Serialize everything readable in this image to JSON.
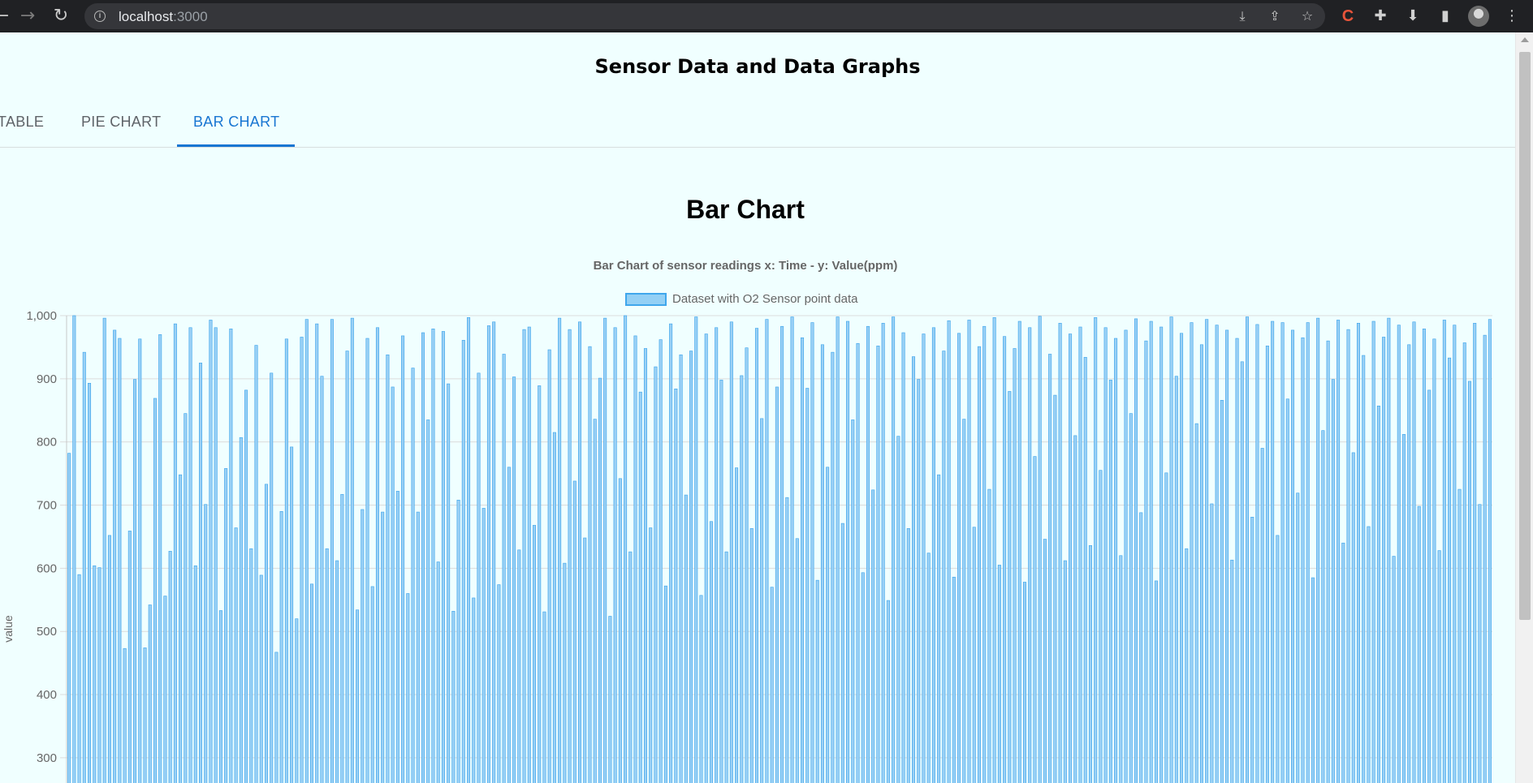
{
  "browser": {
    "url_host": "localhost",
    "url_port": ":3000",
    "back_icon": "back-arrow-icon",
    "forward_icon": "forward-arrow-icon",
    "reload_icon": "reload-icon",
    "extension_badge": "C"
  },
  "page": {
    "title": "Sensor Data and Data Graphs"
  },
  "tabs": [
    {
      "label": "TABLE",
      "active": false
    },
    {
      "label": "PIE CHART",
      "active": false
    },
    {
      "label": "BAR CHART",
      "active": true
    }
  ],
  "chart_section": {
    "heading": "Bar Chart"
  },
  "chart_data": {
    "type": "bar",
    "title": "Bar Chart of sensor readings x: Time - y: Value(ppm)",
    "ylabel": "value",
    "xlabel": "",
    "ylim_visible": [
      260,
      1000
    ],
    "ytick_labels": [
      "1,000",
      "900",
      "800",
      "700",
      "600",
      "500",
      "400",
      "300"
    ],
    "grid": true,
    "legend_position": "top-center",
    "series": [
      {
        "name": "Dataset with O2 Sensor point data",
        "fill_color": "#9ad0f5",
        "border_color": "#36a2eb",
        "values": [
          782,
          1000,
          590,
          942,
          893,
          604,
          601,
          996,
          652,
          977,
          964,
          473,
          659,
          899,
          963,
          474,
          542,
          869,
          970,
          556,
          627,
          987,
          748,
          845,
          981,
          604,
          925,
          701,
          993,
          981,
          533,
          758,
          979,
          664,
          807,
          882,
          631,
          953,
          589,
          733,
          909,
          467,
          690,
          963,
          792,
          520,
          966,
          994,
          575,
          987,
          904,
          631,
          994,
          612,
          717,
          944,
          996,
          534,
          693,
          964,
          571,
          981,
          689,
          938,
          887,
          722,
          968,
          560,
          917,
          689,
          973,
          835,
          979,
          610,
          975,
          892,
          532,
          708,
          961,
          997,
          553,
          909,
          695,
          984,
          990,
          574,
          939,
          760,
          903,
          629,
          978,
          982,
          668,
          889,
          531,
          946,
          815,
          996,
          608,
          978,
          738,
          990,
          648,
          951,
          836,
          901,
          996,
          524,
          981,
          742,
          1000,
          626,
          968,
          879,
          948,
          664,
          919,
          962,
          572,
          987,
          884,
          938,
          716,
          944,
          998,
          557,
          971,
          674,
          981,
          898,
          626,
          990,
          759,
          905,
          949,
          663,
          980,
          837,
          994,
          570,
          887,
          983,
          712,
          998,
          647,
          965,
          885,
          989,
          581,
          954,
          760,
          942,
          998,
          671,
          991,
          835,
          956,
          593,
          983,
          724,
          952,
          988,
          549,
          998,
          809,
          973,
          663,
          935,
          899,
          971,
          624,
          981,
          748,
          944,
          992,
          586,
          972,
          836,
          993,
          665,
          951,
          983,
          725,
          997,
          605,
          967,
          880,
          948,
          991,
          578,
          981,
          777,
          999,
          646,
          939,
          874,
          988,
          612,
          971,
          810,
          982,
          934,
          636,
          997,
          755,
          981,
          898,
          964,
          620,
          977,
          845,
          995,
          688,
          960,
          991,
          580,
          982,
          751,
          998,
          904,
          972,
          631,
          989,
          829,
          954,
          994,
          702,
          985,
          866,
          977,
          613,
          964,
          927,
          998,
          681,
          986,
          790,
          952,
          991,
          652,
          989,
          868,
          977,
          719,
          965,
          989,
          585,
          996,
          818,
          960,
          899,
          993,
          640,
          978,
          783,
          988,
          937,
          666,
          991,
          857,
          966,
          996,
          619,
          985,
          812,
          954,
          990,
          698,
          979,
          882,
          963,
          628,
          993,
          933,
          985,
          725,
          957,
          896,
          988,
          701,
          969,
          994
        ]
      }
    ]
  }
}
